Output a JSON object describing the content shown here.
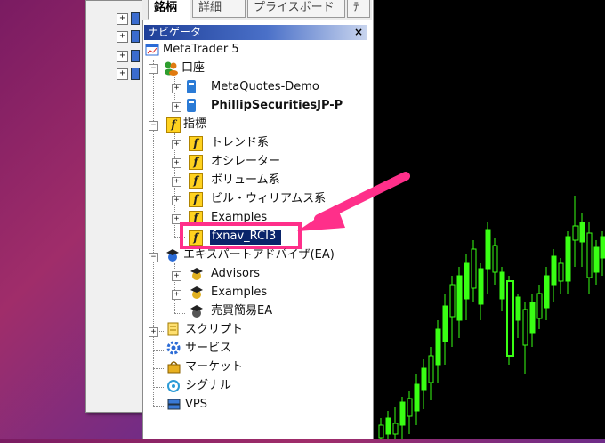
{
  "tabs": {
    "active": "銘柄",
    "second": "詳細",
    "third": "プライスボード",
    "fourth": "ﾃ"
  },
  "navigator": {
    "title": "ナビゲータ",
    "close": "×",
    "root": "MetaTrader 5",
    "accounts": {
      "label": "口座",
      "items": [
        "MetaQuotes-Demo",
        "PhillipSecuritiesJP-P"
      ]
    },
    "indicators": {
      "label": "指標",
      "items": [
        "トレンド系",
        "オシレーター",
        "ボリューム系",
        "ビル・ウィリアムス系",
        "Examples"
      ],
      "selected": "fxnav_RCI3"
    },
    "experts": {
      "label": "エキスパートアドバイザ(EA)",
      "items": [
        "Advisors",
        "Examples",
        "売買簡易EA"
      ]
    },
    "others": [
      "スクリプト",
      "サービス",
      "マーケット",
      "シグナル",
      "VPS"
    ]
  },
  "colors": {
    "highlight": "#ff2f8a",
    "selection": "#0a246a",
    "candle": "#39ff14"
  },
  "icons": {
    "root": "window-icon",
    "accounts": "people-icon",
    "indicator": "function-f-icon",
    "experts": "expert-hat-icon",
    "scripts": "script-icon",
    "services": "gear-icon",
    "market": "basket-icon",
    "signals": "signal-icon",
    "vps": "server-icon"
  }
}
